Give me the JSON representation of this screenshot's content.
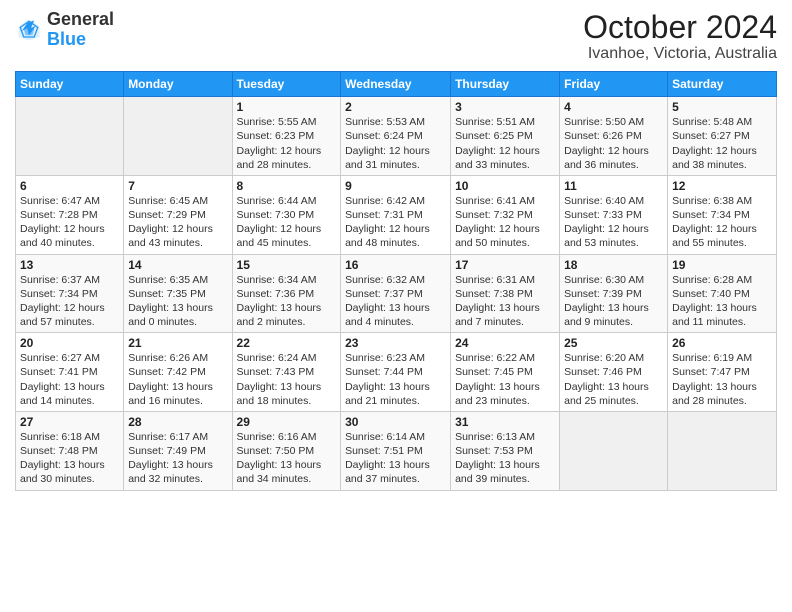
{
  "header": {
    "logo_general": "General",
    "logo_blue": "Blue",
    "title": "October 2024",
    "subtitle": "Ivanhoe, Victoria, Australia"
  },
  "days_of_week": [
    "Sunday",
    "Monday",
    "Tuesday",
    "Wednesday",
    "Thursday",
    "Friday",
    "Saturday"
  ],
  "weeks": [
    [
      {
        "num": "",
        "sunrise": "",
        "sunset": "",
        "daylight": ""
      },
      {
        "num": "",
        "sunrise": "",
        "sunset": "",
        "daylight": ""
      },
      {
        "num": "1",
        "sunrise": "Sunrise: 5:55 AM",
        "sunset": "Sunset: 6:23 PM",
        "daylight": "Daylight: 12 hours and 28 minutes."
      },
      {
        "num": "2",
        "sunrise": "Sunrise: 5:53 AM",
        "sunset": "Sunset: 6:24 PM",
        "daylight": "Daylight: 12 hours and 31 minutes."
      },
      {
        "num": "3",
        "sunrise": "Sunrise: 5:51 AM",
        "sunset": "Sunset: 6:25 PM",
        "daylight": "Daylight: 12 hours and 33 minutes."
      },
      {
        "num": "4",
        "sunrise": "Sunrise: 5:50 AM",
        "sunset": "Sunset: 6:26 PM",
        "daylight": "Daylight: 12 hours and 36 minutes."
      },
      {
        "num": "5",
        "sunrise": "Sunrise: 5:48 AM",
        "sunset": "Sunset: 6:27 PM",
        "daylight": "Daylight: 12 hours and 38 minutes."
      }
    ],
    [
      {
        "num": "6",
        "sunrise": "Sunrise: 6:47 AM",
        "sunset": "Sunset: 7:28 PM",
        "daylight": "Daylight: 12 hours and 40 minutes."
      },
      {
        "num": "7",
        "sunrise": "Sunrise: 6:45 AM",
        "sunset": "Sunset: 7:29 PM",
        "daylight": "Daylight: 12 hours and 43 minutes."
      },
      {
        "num": "8",
        "sunrise": "Sunrise: 6:44 AM",
        "sunset": "Sunset: 7:30 PM",
        "daylight": "Daylight: 12 hours and 45 minutes."
      },
      {
        "num": "9",
        "sunrise": "Sunrise: 6:42 AM",
        "sunset": "Sunset: 7:31 PM",
        "daylight": "Daylight: 12 hours and 48 minutes."
      },
      {
        "num": "10",
        "sunrise": "Sunrise: 6:41 AM",
        "sunset": "Sunset: 7:32 PM",
        "daylight": "Daylight: 12 hours and 50 minutes."
      },
      {
        "num": "11",
        "sunrise": "Sunrise: 6:40 AM",
        "sunset": "Sunset: 7:33 PM",
        "daylight": "Daylight: 12 hours and 53 minutes."
      },
      {
        "num": "12",
        "sunrise": "Sunrise: 6:38 AM",
        "sunset": "Sunset: 7:34 PM",
        "daylight": "Daylight: 12 hours and 55 minutes."
      }
    ],
    [
      {
        "num": "13",
        "sunrise": "Sunrise: 6:37 AM",
        "sunset": "Sunset: 7:34 PM",
        "daylight": "Daylight: 12 hours and 57 minutes."
      },
      {
        "num": "14",
        "sunrise": "Sunrise: 6:35 AM",
        "sunset": "Sunset: 7:35 PM",
        "daylight": "Daylight: 13 hours and 0 minutes."
      },
      {
        "num": "15",
        "sunrise": "Sunrise: 6:34 AM",
        "sunset": "Sunset: 7:36 PM",
        "daylight": "Daylight: 13 hours and 2 minutes."
      },
      {
        "num": "16",
        "sunrise": "Sunrise: 6:32 AM",
        "sunset": "Sunset: 7:37 PM",
        "daylight": "Daylight: 13 hours and 4 minutes."
      },
      {
        "num": "17",
        "sunrise": "Sunrise: 6:31 AM",
        "sunset": "Sunset: 7:38 PM",
        "daylight": "Daylight: 13 hours and 7 minutes."
      },
      {
        "num": "18",
        "sunrise": "Sunrise: 6:30 AM",
        "sunset": "Sunset: 7:39 PM",
        "daylight": "Daylight: 13 hours and 9 minutes."
      },
      {
        "num": "19",
        "sunrise": "Sunrise: 6:28 AM",
        "sunset": "Sunset: 7:40 PM",
        "daylight": "Daylight: 13 hours and 11 minutes."
      }
    ],
    [
      {
        "num": "20",
        "sunrise": "Sunrise: 6:27 AM",
        "sunset": "Sunset: 7:41 PM",
        "daylight": "Daylight: 13 hours and 14 minutes."
      },
      {
        "num": "21",
        "sunrise": "Sunrise: 6:26 AM",
        "sunset": "Sunset: 7:42 PM",
        "daylight": "Daylight: 13 hours and 16 minutes."
      },
      {
        "num": "22",
        "sunrise": "Sunrise: 6:24 AM",
        "sunset": "Sunset: 7:43 PM",
        "daylight": "Daylight: 13 hours and 18 minutes."
      },
      {
        "num": "23",
        "sunrise": "Sunrise: 6:23 AM",
        "sunset": "Sunset: 7:44 PM",
        "daylight": "Daylight: 13 hours and 21 minutes."
      },
      {
        "num": "24",
        "sunrise": "Sunrise: 6:22 AM",
        "sunset": "Sunset: 7:45 PM",
        "daylight": "Daylight: 13 hours and 23 minutes."
      },
      {
        "num": "25",
        "sunrise": "Sunrise: 6:20 AM",
        "sunset": "Sunset: 7:46 PM",
        "daylight": "Daylight: 13 hours and 25 minutes."
      },
      {
        "num": "26",
        "sunrise": "Sunrise: 6:19 AM",
        "sunset": "Sunset: 7:47 PM",
        "daylight": "Daylight: 13 hours and 28 minutes."
      }
    ],
    [
      {
        "num": "27",
        "sunrise": "Sunrise: 6:18 AM",
        "sunset": "Sunset: 7:48 PM",
        "daylight": "Daylight: 13 hours and 30 minutes."
      },
      {
        "num": "28",
        "sunrise": "Sunrise: 6:17 AM",
        "sunset": "Sunset: 7:49 PM",
        "daylight": "Daylight: 13 hours and 32 minutes."
      },
      {
        "num": "29",
        "sunrise": "Sunrise: 6:16 AM",
        "sunset": "Sunset: 7:50 PM",
        "daylight": "Daylight: 13 hours and 34 minutes."
      },
      {
        "num": "30",
        "sunrise": "Sunrise: 6:14 AM",
        "sunset": "Sunset: 7:51 PM",
        "daylight": "Daylight: 13 hours and 37 minutes."
      },
      {
        "num": "31",
        "sunrise": "Sunrise: 6:13 AM",
        "sunset": "Sunset: 7:53 PM",
        "daylight": "Daylight: 13 hours and 39 minutes."
      },
      {
        "num": "",
        "sunrise": "",
        "sunset": "",
        "daylight": ""
      },
      {
        "num": "",
        "sunrise": "",
        "sunset": "",
        "daylight": ""
      }
    ]
  ]
}
